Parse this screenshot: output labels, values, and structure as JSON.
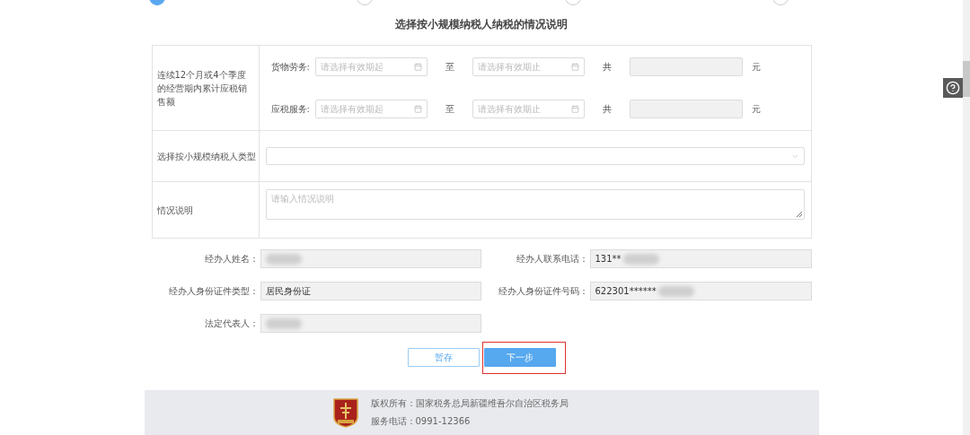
{
  "steps": [
    {
      "selected": true
    },
    {
      "selected": false
    },
    {
      "selected": false
    },
    {
      "selected": false
    }
  ],
  "title": "选择按小规模纳税人纳税的情况说明",
  "sales": {
    "label": "连续12个月或4个季度的经营期内累计应税销售额",
    "rows": [
      {
        "label": "货物劳务:",
        "start_placeholder": "请选择有效期起",
        "to": "至",
        "end_placeholder": "请选择有效期止",
        "total_label": "共",
        "unit": "元"
      },
      {
        "label": "应税服务:",
        "start_placeholder": "请选择有效期起",
        "to": "至",
        "end_placeholder": "请选择有效期止",
        "total_label": "共",
        "unit": "元"
      }
    ]
  },
  "taxpayer_type": {
    "label": "选择按小规模纳税人类型"
  },
  "description": {
    "label": "情况说明",
    "placeholder": "请输入情况说明"
  },
  "contact_fields": [
    {
      "label": "经办人姓名：",
      "redacted": true
    },
    {
      "label": "经办人联系电话：",
      "value": "131**",
      "redacted": true
    },
    {
      "label": "经办人身份证件类型：",
      "value": "居民身份证",
      "redacted": false
    },
    {
      "label": "经办人身份证件号码：",
      "value": "622301******",
      "redacted": true
    },
    {
      "label": "法定代表人：",
      "redacted": true
    }
  ],
  "buttons": [
    {
      "label": "暂存",
      "kind": "secondary",
      "highlighted": false
    },
    {
      "label": "下一步",
      "kind": "primary",
      "highlighted": true
    }
  ],
  "footer": {
    "copyright": "版权所有：国家税务总局新疆维吾尔自治区税务局",
    "phone": "服务电话：0991-12366"
  }
}
